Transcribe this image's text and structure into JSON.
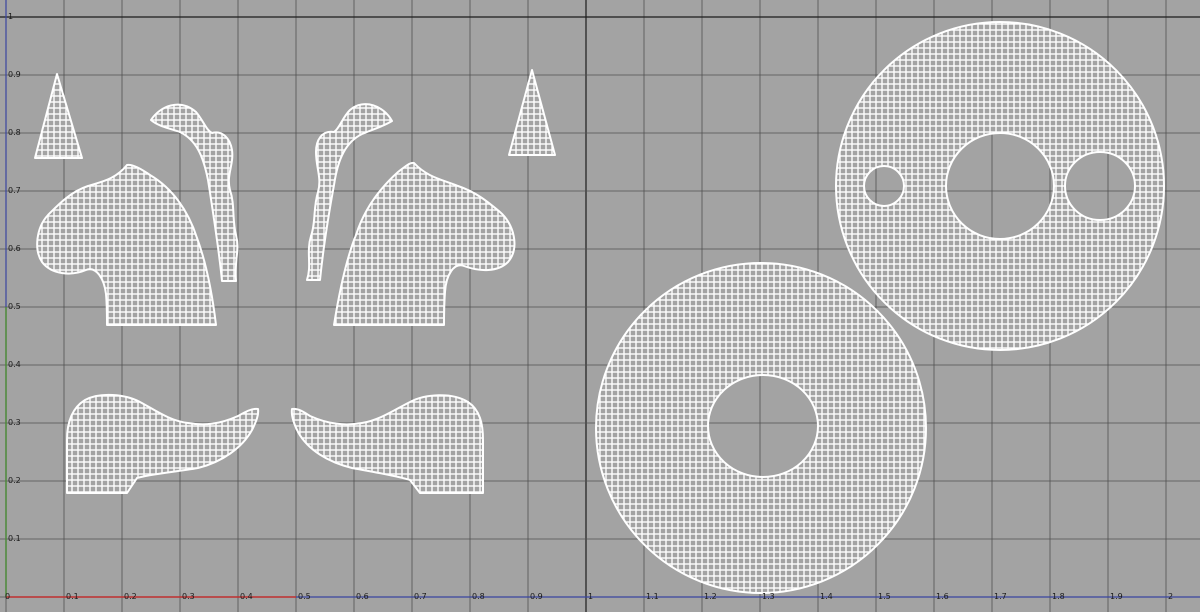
{
  "uv_grid": {
    "origin_label": "0",
    "u_ticks": [
      "0.1",
      "0.2",
      "0.3",
      "0.4",
      "0.5",
      "0.6",
      "0.7",
      "0.8",
      "0.9",
      "1",
      "1.1",
      "1.2",
      "1.3",
      "1.4",
      "1.5",
      "1.6",
      "1.7",
      "1.8",
      "1.9",
      "2"
    ],
    "v_ticks": [
      "0.1",
      "0.2",
      "0.3",
      "0.4",
      "0.5",
      "0.6",
      "0.7",
      "0.8",
      "0.9",
      "1"
    ],
    "u_range": [
      0,
      2
    ],
    "v_range": [
      0,
      1.03
    ],
    "grid_step": 0.1,
    "major_line_at_u": 1,
    "major_line_at_v": 1
  },
  "colors": {
    "background": "#a3a3a3",
    "grid_line": "#505050",
    "major_grid_line": "#1c1c1c",
    "u_axis": "#c03030",
    "v_axis": "#4d8a3a",
    "axis_extension": "#3a46a0",
    "uv_wire": "#ffffff"
  },
  "uv_shells": [
    "left-small-triangle-shell",
    "right-small-triangle-shell",
    "left-curved-strip-shell",
    "right-curved-strip-shell",
    "left-wing-shell",
    "right-wing-shell",
    "left-bottom-tail-shell",
    "right-bottom-tail-shell",
    "bottom-ring-disc-shell",
    "top-disc-three-holes-shell"
  ]
}
